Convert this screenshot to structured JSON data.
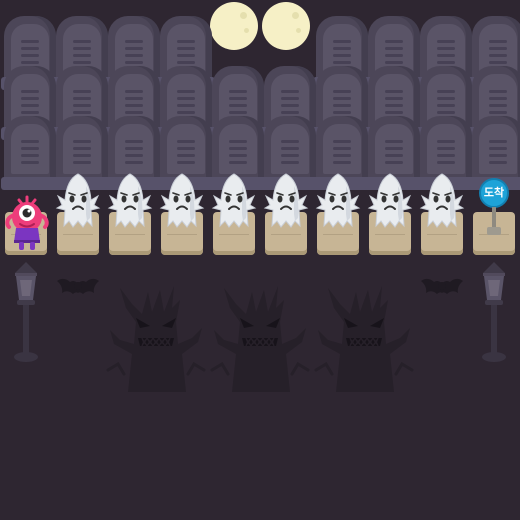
{
  "game": {
    "goal_label": "도착",
    "board": {
      "start_column": 0,
      "goal_column": 9,
      "ghost_columns": [
        1,
        2,
        3,
        4,
        5,
        6,
        7,
        8
      ]
    }
  },
  "colors": {
    "background": "#2e2631",
    "tombstone": "#4c4658",
    "tile": "#c7b595",
    "ghost": "#e9ecef",
    "moon": "#f6f0c6",
    "goal_sign": "#1ea3d8",
    "player": "#ee3d7b"
  },
  "icons": {
    "player": "pink-one-eyed-monster-icon",
    "obstacle": "ghost-icon",
    "goal": "goal-sign-icon",
    "decor": [
      "moon-icon",
      "tombstone-icon",
      "street-lamp-icon",
      "bat-icon",
      "spooky-tree-icon"
    ]
  }
}
